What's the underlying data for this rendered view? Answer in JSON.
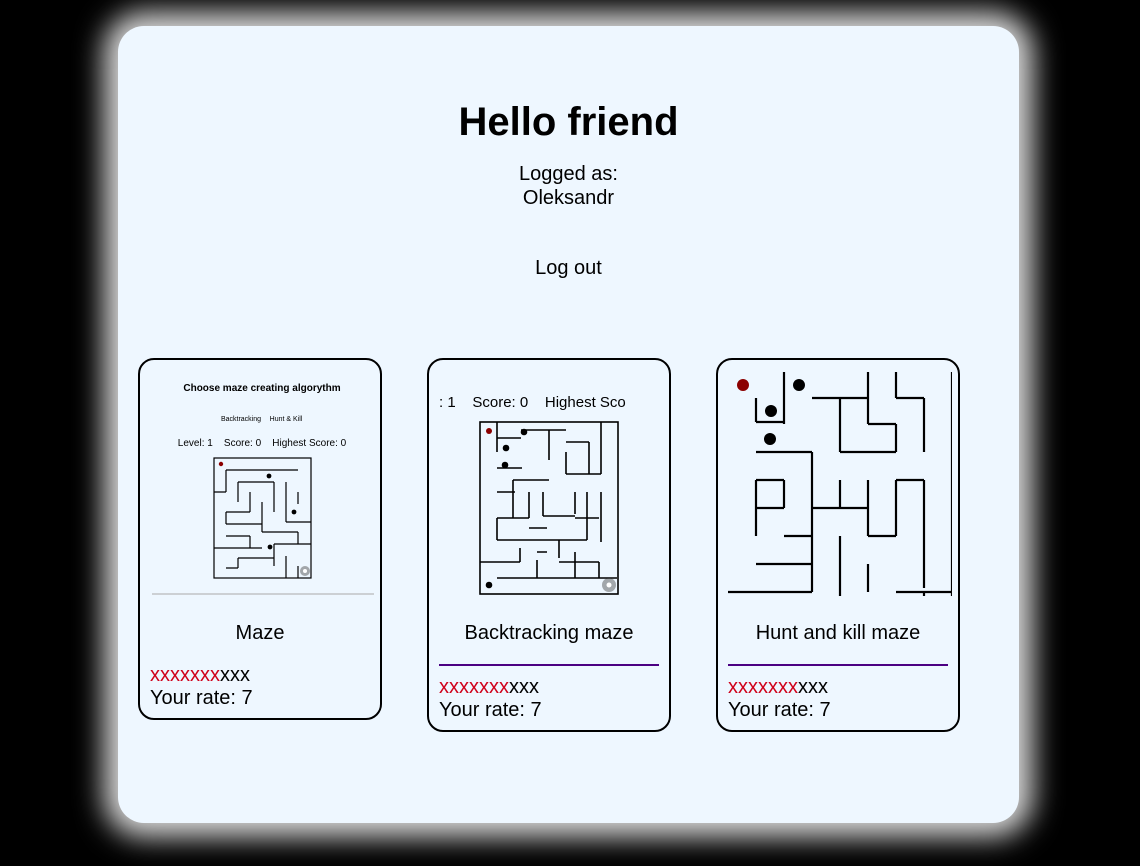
{
  "header": {
    "title": "Hello friend",
    "logged_label": "Logged as:",
    "username": "Oleksandr",
    "logout_label": "Log out"
  },
  "cards": [
    {
      "title": "Maze",
      "stars_filled": "xxxxxxx",
      "stars_empty": "xxx",
      "rate_text": "Your rate: 7",
      "thumb": {
        "heading": "Choose maze creating algorythm",
        "option_1": "Backtracking",
        "option_2": "Hunt & Kill",
        "stats": "Level: 1    Score: 0    Highest Score: 0"
      }
    },
    {
      "title": "Backtracking maze",
      "stars_filled": "xxxxxxx",
      "stars_empty": "xxx",
      "rate_text": "Your rate: 7",
      "thumb": {
        "stats": ": 1    Score: 0    Highest Sco"
      }
    },
    {
      "title": "Hunt and kill maze",
      "stars_filled": "xxxxxxx",
      "stars_empty": "xxx",
      "rate_text": "Your rate: 7"
    }
  ],
  "colors": {
    "background": "#000000",
    "panel": "#eef7ff",
    "stars_red": "#d0021b",
    "player_dot": "#8b0000",
    "separator_purple": "#4b0082"
  },
  "icons": [
    "maze-preview-image",
    "player-dot-icon",
    "enemy-dot-icon",
    "exit-portal-icon"
  ]
}
